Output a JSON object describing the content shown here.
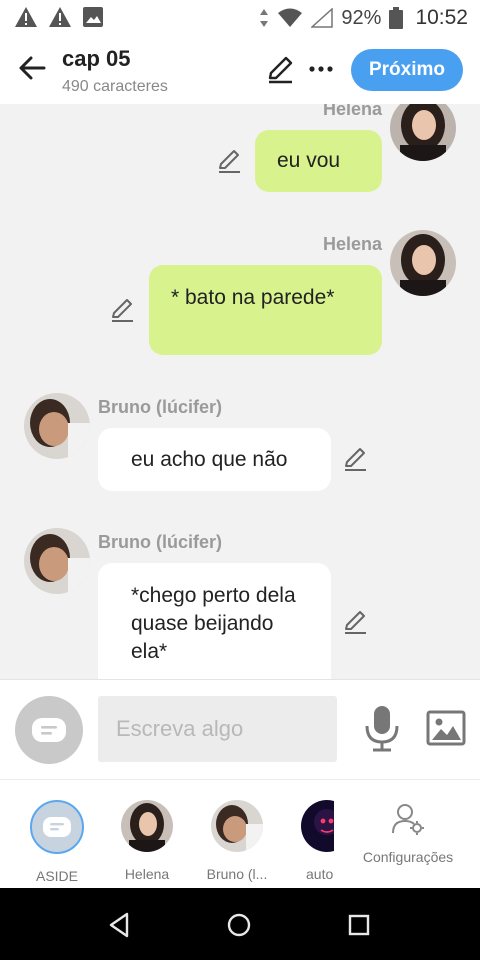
{
  "status_bar": {
    "battery_pct": "92%",
    "time": "10:52",
    "icons": [
      "warning-icon",
      "warning-icon",
      "image-icon",
      "data-arrows-icon",
      "wifi-icon",
      "signal-icon",
      "battery-icon"
    ]
  },
  "header": {
    "title": "cap 05",
    "subtitle": "490 caracteres",
    "next_label": "Próximo",
    "accent_color": "#4aa0f0"
  },
  "messages": [
    {
      "sender": "Helena",
      "text": "eu vou",
      "side": "sent"
    },
    {
      "sender": "Helena",
      "text": "* bato na parede*",
      "side": "sent"
    },
    {
      "sender": "Bruno (lúcifer)",
      "text": "eu acho que não",
      "side": "received"
    },
    {
      "sender": "Bruno (lúcifer)",
      "text": "*chego perto dela quase beijando ela*",
      "side": "received"
    }
  ],
  "colors": {
    "sent_bubble": "#d8f28e",
    "received_bubble": "#ffffff",
    "chat_background": "#f2f2f2"
  },
  "input": {
    "placeholder": "Escreva algo"
  },
  "characters": [
    {
      "label": "ASIDE"
    },
    {
      "label": "Helena"
    },
    {
      "label": "Bruno (l..."
    },
    {
      "label": "auto"
    }
  ],
  "settings": {
    "label": "Configurações"
  },
  "nav": {
    "icons": [
      "back-triangle-icon",
      "home-circle-icon",
      "recents-square-icon"
    ]
  }
}
